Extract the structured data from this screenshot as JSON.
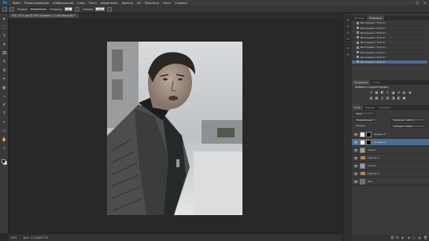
{
  "menubar": {
    "logo": "Ps",
    "items": [
      "Файл",
      "Редактирование",
      "Изображение",
      "Слои",
      "Текст",
      "Выделение",
      "Фильтр",
      "3D",
      "Просмотр",
      "Окно",
      "Справка"
    ],
    "controls": [
      "–",
      "□",
      "×"
    ]
  },
  "options": {
    "labels": [
      "Режим:",
      "Непрозр.:",
      "Нажим:"
    ],
    "mode_value": "Нормальный",
    "opacity_value": "1%",
    "pressure_value": "100%"
  },
  "document": {
    "tab_title": "IMG_3571.jpg @ 50% (Кривые 1, Слой-маска/8) *"
  },
  "toolbar": {
    "tools": [
      "▸",
      "⬚",
      "ℓ",
      "✦",
      "⌧",
      "✎",
      "⊘",
      "✏",
      "◐",
      "⌁",
      "✐",
      "T",
      "↖",
      "▭",
      "✋",
      "⌕"
    ]
  },
  "status": {
    "zoom": "50%",
    "doc_info": "Док: 17,2M/63,7M"
  },
  "history": {
    "tabs": [
      "История",
      "Операции"
    ],
    "items": [
      {
        "label": "Инструмент \"Кисть\"",
        "selected": false
      },
      {
        "label": "Инструмент \"Кисть\"",
        "selected": false
      },
      {
        "label": "Инструмент \"Кисть\"",
        "selected": false
      },
      {
        "label": "Инструмент \"Кисть\"",
        "selected": false
      },
      {
        "label": "Инструмент \"Кисть\"",
        "selected": false
      },
      {
        "label": "Инструмент \"Кисть\"",
        "selected": false
      },
      {
        "label": "Инструмент \"Кисть\"",
        "selected": false
      },
      {
        "label": "Инструмент \"Кисть\"",
        "selected": false
      },
      {
        "label": "Инструмент \"Кисть\"",
        "selected": true
      }
    ]
  },
  "adjustments": {
    "tabs": [
      "Коррекция",
      "Стили"
    ],
    "title": "Добавить корректировку",
    "icons": [
      "☀",
      "▦",
      "◩",
      "▽",
      "◪",
      "⚖",
      "▤",
      "◑",
      "▧",
      "▩",
      "◫",
      "▥",
      "◨",
      "◧",
      "▣"
    ]
  },
  "layers": {
    "tabs": [
      "Слои",
      "Каналы",
      "Контуры"
    ],
    "kind_label": "Вид",
    "blend_mode": "Нормальный",
    "opacity": "Непрозр.: 100%",
    "lock_label": "Закреп.:",
    "fill": "Заливка: 100%",
    "rows": [
      {
        "name": "Кривые 2",
        "type": "adjust",
        "selected": false
      },
      {
        "name": "Кривые 1",
        "type": "adjust",
        "selected": true
      },
      {
        "name": "Слой 4",
        "type": "pixel",
        "selected": false
      },
      {
        "name": "Группа 3",
        "type": "group",
        "selected": false
      },
      {
        "name": "Слой 1",
        "type": "pixel",
        "selected": false
      },
      {
        "name": "Группа 2",
        "type": "group",
        "selected": false
      },
      {
        "name": "Фон",
        "type": "background",
        "selected": false
      }
    ],
    "footer_icons": [
      "⛓",
      "fx",
      "◐",
      "◑",
      "▢",
      "▤",
      "🗑"
    ]
  }
}
